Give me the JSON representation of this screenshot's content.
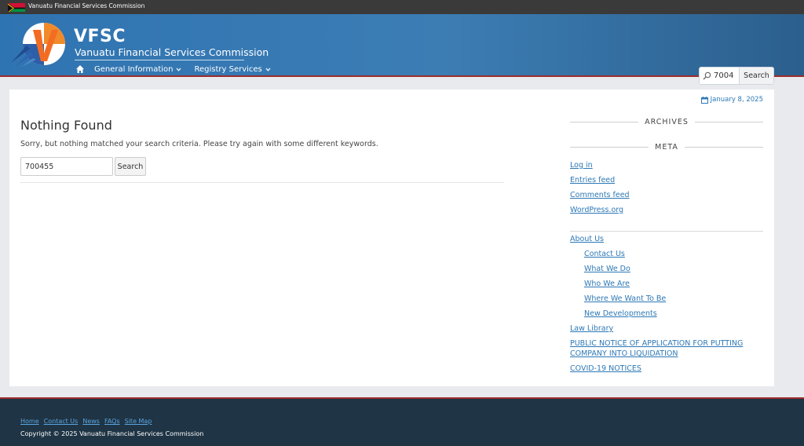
{
  "topbar": {
    "title": "Vanuatu Financial Services Commission"
  },
  "header": {
    "brand": "VFSC",
    "subtitle": "Vanuatu Financial Services Commission",
    "nav": [
      {
        "label": "General Information"
      },
      {
        "label": "Registry Services"
      }
    ],
    "search": {
      "value": "7004",
      "button": "Search"
    }
  },
  "main": {
    "date": "January 8, 2025",
    "title": "Nothing Found",
    "message": "Sorry, but nothing matched your search criteria. Please try again with some different keywords.",
    "search": {
      "value": "700455",
      "button": "Search"
    }
  },
  "sidebar": {
    "archives_heading": "ARCHIVES",
    "meta_heading": "META",
    "meta_links": [
      "Log in",
      "Entries feed",
      "Comments feed",
      "WordPress.org"
    ],
    "pages": {
      "about": "About Us",
      "about_children": [
        "Contact Us",
        "What We Do",
        "Who We Are",
        "Where We Want To Be",
        "New Developments"
      ],
      "law_library": "Law Library",
      "public_notice_line1": "PUBLIC NOTICE OF APPLICATION FOR PUTTING",
      "public_notice_line2": "COMPANY INTO LIQUIDATION",
      "covid": "COVID-19 NOTICES"
    }
  },
  "footer": {
    "links": [
      "Home",
      "Contact Us",
      "News",
      "FAQs",
      "Site Map"
    ],
    "copyright": "Copyright © 2025 Vanuatu Financial Services Commission"
  },
  "colors": {
    "header_blue": "#2f74b2",
    "accent_red": "#9b2d2d",
    "link_blue": "#2d78b6",
    "footer_bg": "#1f3444"
  }
}
